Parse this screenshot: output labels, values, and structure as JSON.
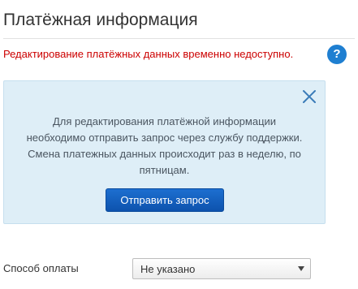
{
  "header": {
    "title": "Платёжная информация"
  },
  "warning": {
    "text": "Редактирование платёжных данных временно недоступно.",
    "help_icon": "question-mark-icon",
    "help_glyph": "?"
  },
  "info_box": {
    "message": "Для редактирования платёжной информации необходимо отправить запрос через службу поддержки. Смена платежных данных происходит раз в неделю, по пятницам.",
    "close_icon": "close-icon",
    "button_label": "Отправить запрос"
  },
  "payment_method": {
    "label": "Способ оплаты",
    "selected": "Не указано"
  },
  "colors": {
    "warning": "#cc0000",
    "accent": "#1f7fd1",
    "info_bg": "#deeef7",
    "button": "#0d52ad"
  }
}
